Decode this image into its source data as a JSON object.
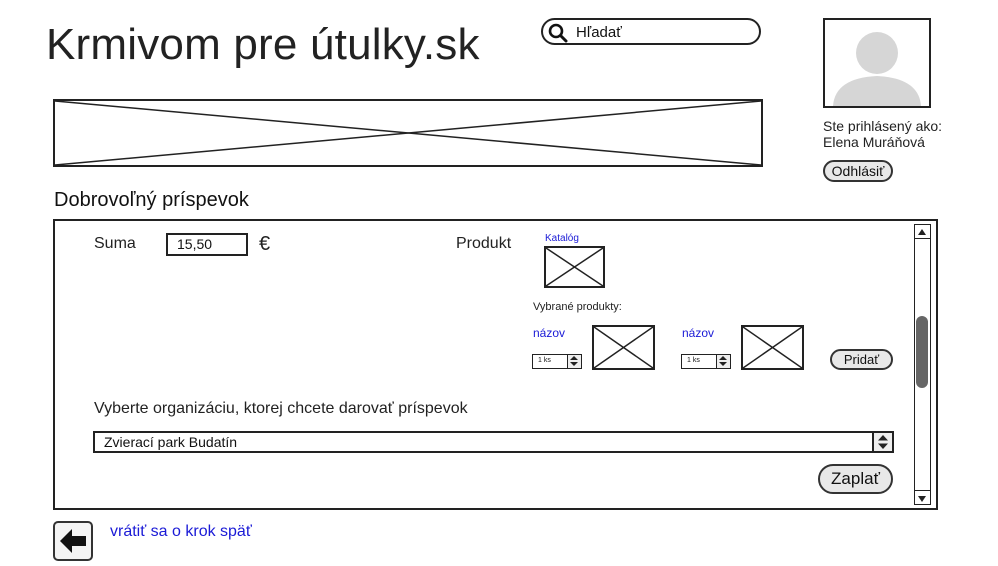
{
  "header": {
    "site_title": "Krmivom pre útulky.sk",
    "search_placeholder": "Hľadať"
  },
  "user": {
    "logged_in_label": "Ste prihlásený ako:",
    "name": "Elena Muráňová",
    "logout_label": "Odhlásiť"
  },
  "donation": {
    "section_title": "Dobrovoľný príspevok",
    "amount_label": "Suma",
    "amount_value": "15,50",
    "currency": "€",
    "product_label": "Produkt",
    "catalog_link": "Katalóg",
    "selected_products_label": "Vybrané produkty:",
    "selected_products": [
      {
        "name": "názov",
        "quantity": "1 ks"
      },
      {
        "name": "názov",
        "quantity": "1 ks"
      }
    ],
    "add_label": "Pridať",
    "org_prompt": "Vyberte organizáciu, ktorej chcete darovať príspevok",
    "org_selected": "Zvierací park Budatín",
    "pay_label": "Zaplať"
  },
  "footer": {
    "back_link": "vrátiť sa o krok späť"
  },
  "colors": {
    "link": "#1a1ad6",
    "border": "#222222",
    "button_bg": "#e8e8e8"
  }
}
